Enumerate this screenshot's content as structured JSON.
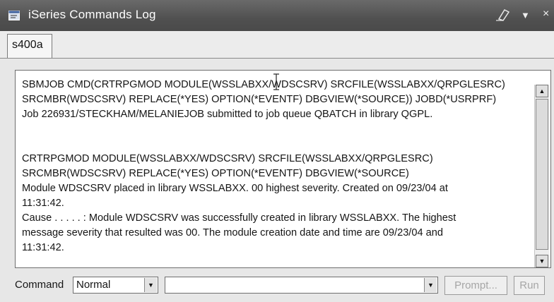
{
  "window": {
    "title": "iSeries Commands Log",
    "icons": {
      "app": "log-window-icon",
      "eraser": "eraser-icon",
      "menu": "view-menu-icon",
      "close": "close-icon"
    },
    "close_glyph": "×"
  },
  "tabs": [
    {
      "label": "s400a",
      "active": true
    }
  ],
  "log": {
    "lines": [
      "SBMJOB CMD(CRTRPGMOD MODULE(WSSLABXX/WDSCSRV) SRCFILE(WSSLABXX/QRPGLESRC)",
      "SRCMBR(WDSCSRV) REPLACE(*YES) OPTION(*EVENTF) DBGVIEW(*SOURCE)) JOBD(*USRPRF)",
      "Job 226931/STECKHAM/MELANIEJOB submitted to job queue QBATCH in library QGPL.",
      "CRTRPGMOD MODULE(WSSLABXX/WDSCSRV) SRCFILE(WSSLABXX/QRPGLESRC)",
      "SRCMBR(WDSCSRV) REPLACE(*YES) OPTION(*EVENTF) DBGVIEW(*SOURCE)",
      "Module WDSCSRV placed in library WSSLABXX. 00 highest severity. Created on 09/23/04 at",
      "11:31:42.",
      "Cause . . . . . :   Module WDSCSRV was successfully created in library WSSLABXX. The highest",
      "message severity that resulted was 00. The module creation date and time are 09/23/04 and",
      "11:31:42."
    ]
  },
  "command_bar": {
    "label": "Command",
    "mode_selected": "Normal",
    "command_value": "",
    "prompt_label": "Prompt...",
    "run_label": "Run",
    "buttons_enabled": false
  },
  "colors": {
    "titlebar": "#505050",
    "panel": "#e7e7e7",
    "disabled_text": "#a6a6a6"
  }
}
